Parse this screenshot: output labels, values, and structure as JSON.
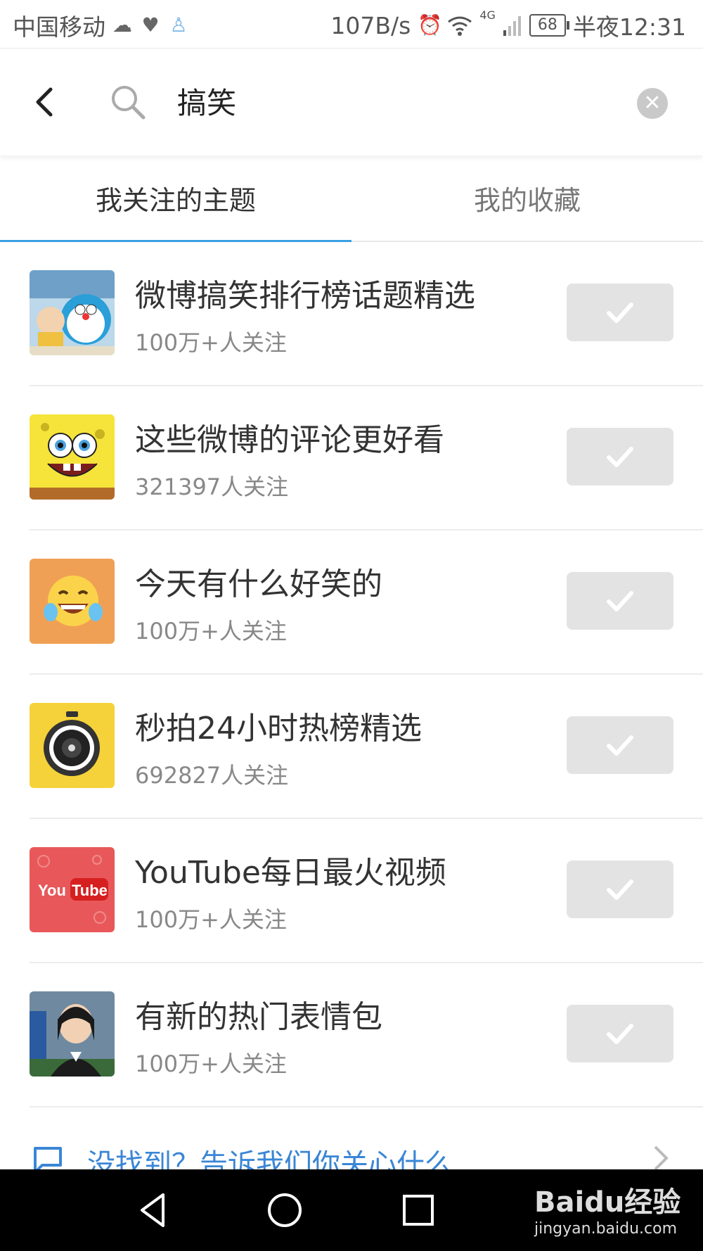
{
  "status_bar": {
    "carrier": "中国移动",
    "speed": "107B/s",
    "network": "4G",
    "battery": "68",
    "time": "半夜12:31",
    "icons": [
      "weather-icon",
      "heart-icon",
      "ghost-icon",
      "alarm-icon",
      "wifi-icon",
      "signal-icon"
    ]
  },
  "search": {
    "query": "搞笑"
  },
  "tabs": [
    {
      "label": "我关注的主题",
      "active": true
    },
    {
      "label": "我的收藏",
      "active": false
    }
  ],
  "topics": [
    {
      "title": "微博搞笑排行榜话题精选",
      "followers": "100万+人关注",
      "thumb": "doraemon"
    },
    {
      "title": "这些微博的评论更好看",
      "followers": "321397人关注",
      "thumb": "spongebob"
    },
    {
      "title": "今天有什么好笑的",
      "followers": "100万+人关注",
      "thumb": "laughing-emoji"
    },
    {
      "title": "秒拍24小时热榜精选",
      "followers": "692827人关注",
      "thumb": "camera-lens"
    },
    {
      "title": "YouTube每日最火视频",
      "followers": "100万+人关注",
      "thumb": "youtube-logo"
    },
    {
      "title": "有新的热门表情包",
      "followers": "100万+人关注",
      "thumb": "news-anchor"
    }
  ],
  "feedback": {
    "label": "没找到？告诉我们你关心什么"
  },
  "watermark": {
    "brand": "Baidu经验",
    "url": "jingyan.baidu.com"
  },
  "colors": {
    "accent": "#3aa0e3",
    "link": "#3a86d6",
    "button_bg": "#e3e3e3"
  }
}
